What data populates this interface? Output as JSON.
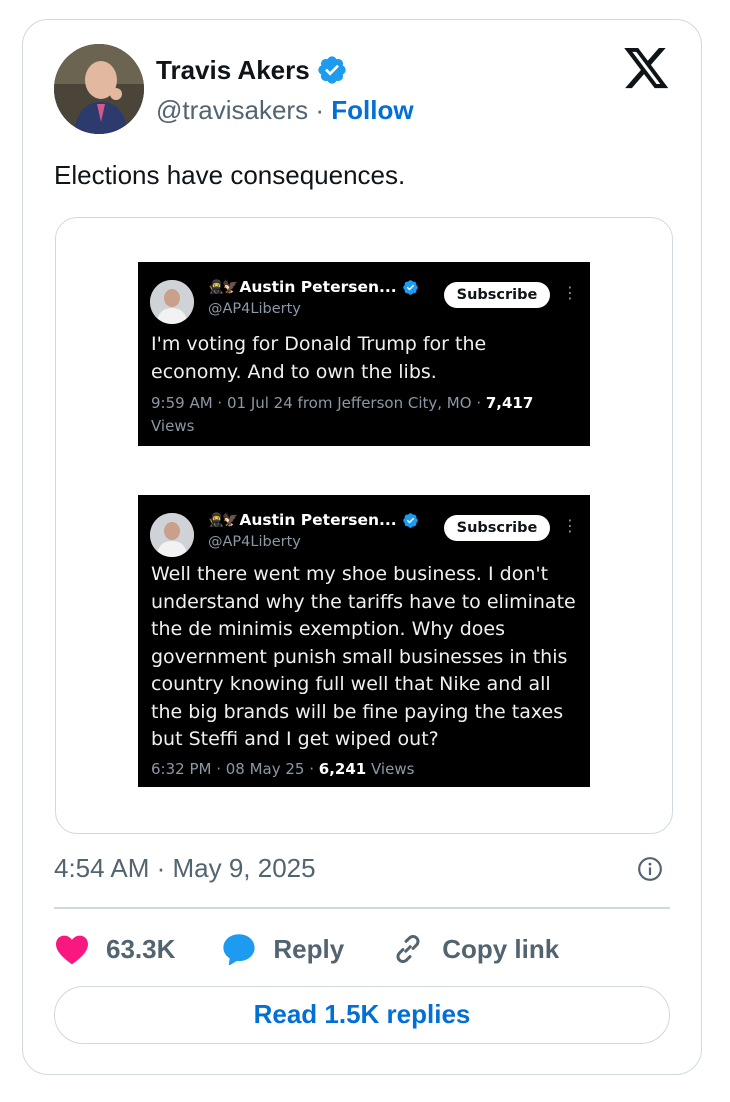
{
  "author": {
    "name": "Travis Akers",
    "handle": "@travisakers",
    "separator": "·",
    "follow_label": "Follow"
  },
  "tweet_text": "Elections have consequences.",
  "embedded_posts": [
    {
      "emoji": "🥷🦅",
      "name": "Austin Petersen...",
      "handle": "@AP4Liberty",
      "subscribe_label": "Subscribe",
      "more": "⋮",
      "text": "I'm voting for Donald Trump for the economy. And to own the libs.",
      "meta_prefix": "9:59 AM · 01 Jul 24 from Jefferson City, MO · ",
      "views_count": "7,417",
      "views_label": " Views"
    },
    {
      "emoji": "🥷🦅",
      "name": "Austin Petersen...",
      "handle": "@AP4Liberty",
      "subscribe_label": "Subscribe",
      "more": "⋮",
      "text": "Well there went my shoe business. I don't understand why the tariffs have to eliminate the de minimis exemption. Why does government punish small businesses in this country knowing full well that Nike and all the big brands will be fine paying the taxes but Steffi and I get wiped out?",
      "meta_prefix": "6:32 PM · 08 May 25 · ",
      "views_count": "6,241",
      "views_label": " Views"
    }
  ],
  "timestamp": "4:54 AM · May 9, 2025",
  "actions": {
    "like_count": "63.3K",
    "reply_label": "Reply",
    "copy_link_label": "Copy link"
  },
  "read_replies_label": "Read 1.5K replies",
  "icons": {
    "verified": "verified-badge-icon",
    "x_logo": "x-logo-icon",
    "info": "info-icon",
    "heart": "heart-icon",
    "reply": "reply-bubble-icon",
    "link": "link-icon"
  },
  "colors": {
    "accent": "#006fd6",
    "verified": "#1d9bf0",
    "heart": "#f91880",
    "muted": "#536471",
    "border": "#cfd9de"
  }
}
